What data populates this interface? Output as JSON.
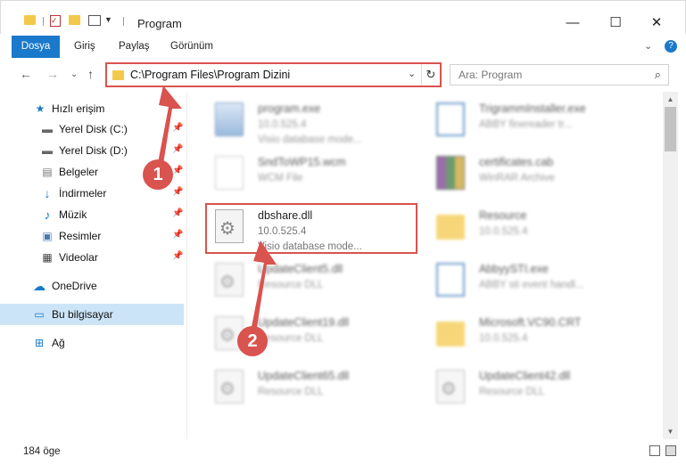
{
  "window": {
    "title": "Program",
    "minimize": "—",
    "maximize": "☐",
    "close": "✕"
  },
  "ribbon": {
    "tabs": [
      "Dosya",
      "Giriş",
      "Paylaş",
      "Görünüm"
    ],
    "expand": "⌄",
    "help": "?"
  },
  "nav": {
    "back": "←",
    "forward": "→",
    "recent": "⌄",
    "up": "↑",
    "address": "C:\\Program Files\\Program Dizini",
    "refresh": "↻",
    "search_placeholder": "Ara: Program"
  },
  "sidebar": {
    "items": [
      {
        "label": "Hızlı erişim",
        "icon": "star-icon"
      },
      {
        "label": "Yerel Disk (C:)",
        "icon": "drive-icon"
      },
      {
        "label": "Yerel Disk (D:)",
        "icon": "drive-icon"
      },
      {
        "label": "Belgeler",
        "icon": "documents-icon"
      },
      {
        "label": "İndirmeler",
        "icon": "download-icon"
      },
      {
        "label": "Müzik",
        "icon": "music-icon"
      },
      {
        "label": "Resimler",
        "icon": "pictures-icon"
      },
      {
        "label": "Videolar",
        "icon": "videos-icon"
      },
      {
        "label": "OneDrive",
        "icon": "cloud-icon"
      },
      {
        "label": "Bu bilgisayar",
        "icon": "computer-icon"
      },
      {
        "label": "Ağ",
        "icon": "network-icon"
      }
    ]
  },
  "files": [
    {
      "name": "program.exe",
      "line2": "10.0.525.4",
      "line3": "Visio database mode...",
      "icon": "exe-icon"
    },
    {
      "name": "TrigrammInstaller.exe",
      "line2": "ABBY finereader tr...",
      "line3": "",
      "icon": "exe-icon"
    },
    {
      "name": "SndToWP15.wcm",
      "line2": "WCM File",
      "line3": "",
      "icon": "doc-icon"
    },
    {
      "name": "certificates.cab",
      "line2": "WinRAR Archive",
      "line3": "",
      "icon": "archive-icon"
    },
    {
      "name": "dbshare.dll",
      "line2": "10.0.525.4",
      "line3": "Visio database mode...",
      "icon": "dll-icon"
    },
    {
      "name": "Resource",
      "line2": "10.0.525.4",
      "line3": "",
      "icon": "folder-icon"
    },
    {
      "name": "UpdateClient5.dll",
      "line2": "Resource DLL",
      "line3": "",
      "icon": "dll-icon"
    },
    {
      "name": "AbbyySTI.exe",
      "line2": "ABBY sti event handl...",
      "line3": "",
      "icon": "exe-icon"
    },
    {
      "name": "UpdateClient19.dll",
      "line2": "Resource DLL",
      "line3": "",
      "icon": "dll-icon"
    },
    {
      "name": "Microsoft.VC90.CRT",
      "line2": "10.0.525.4",
      "line3": "",
      "icon": "folder-icon"
    },
    {
      "name": "UpdateClient65.dll",
      "line2": "Resource DLL",
      "line3": "",
      "icon": "dll-icon"
    },
    {
      "name": "UpdateClient42.dll",
      "line2": "Resource DLL",
      "line3": "",
      "icon": "dll-icon"
    }
  ],
  "annotations": {
    "step1": "1",
    "step2": "2"
  },
  "status": {
    "count": "184 öge"
  },
  "colors": {
    "accent": "#1979ca",
    "highlight": "#d9534f",
    "selected": "#cce4f7"
  }
}
